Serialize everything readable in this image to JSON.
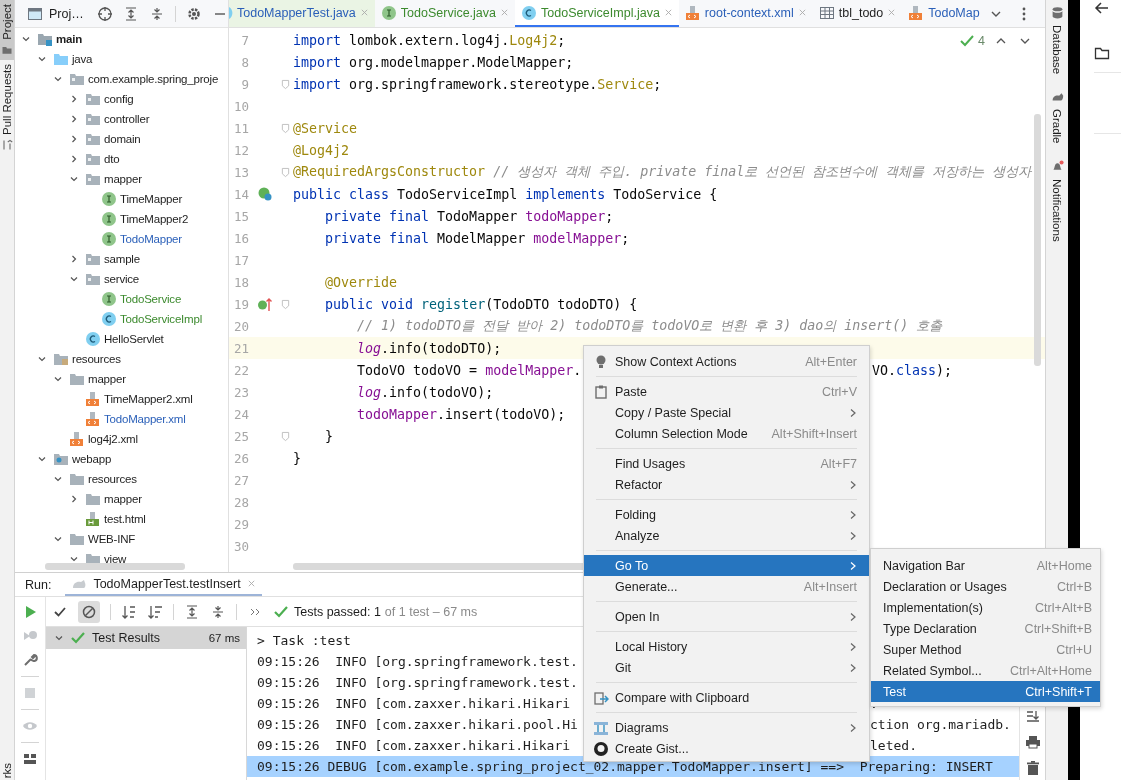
{
  "left_strip": {
    "tools": [
      {
        "label": "Project",
        "kind": "project",
        "selected": true
      },
      {
        "label": "Pull Requests",
        "kind": "pull-requests",
        "selected": false
      }
    ],
    "bottom_tool": "rks"
  },
  "project": {
    "title": "Proj…",
    "tree": [
      {
        "label": "main",
        "kind": "module",
        "added": false,
        "modified": false,
        "expanded": true,
        "children": [
          {
            "label": "java",
            "kind": "source-folder",
            "added": false,
            "modified": false,
            "expanded": true,
            "children": [
              {
                "label": "com.example.spring_proje",
                "kind": "package",
                "added": false,
                "modified": false,
                "expanded": true,
                "children": [
                  {
                    "label": "config",
                    "kind": "package",
                    "added": false,
                    "modified": false,
                    "expanded": false
                  },
                  {
                    "label": "controller",
                    "kind": "package",
                    "added": false,
                    "modified": false,
                    "expanded": false
                  },
                  {
                    "label": "domain",
                    "kind": "package",
                    "added": false,
                    "modified": false,
                    "expanded": false
                  },
                  {
                    "label": "dto",
                    "kind": "package",
                    "added": false,
                    "modified": false,
                    "expanded": false
                  },
                  {
                    "label": "mapper",
                    "kind": "package",
                    "added": false,
                    "modified": false,
                    "expanded": true,
                    "children": [
                      {
                        "label": "TimeMapper",
                        "kind": "interface",
                        "added": false,
                        "modified": false
                      },
                      {
                        "label": "TimeMapper2",
                        "kind": "interface",
                        "added": false,
                        "modified": false
                      },
                      {
                        "label": "TodoMapper",
                        "kind": "interface",
                        "added": false,
                        "modified": true
                      }
                    ]
                  },
                  {
                    "label": "sample",
                    "kind": "package",
                    "added": false,
                    "modified": false,
                    "expanded": false
                  },
                  {
                    "label": "service",
                    "kind": "package",
                    "added": false,
                    "modified": false,
                    "expanded": true,
                    "children": [
                      {
                        "label": "TodoService",
                        "kind": "interface",
                        "added": true,
                        "modified": false
                      },
                      {
                        "label": "TodoServiceImpl",
                        "kind": "class",
                        "added": true,
                        "modified": false
                      }
                    ]
                  },
                  {
                    "label": "HelloServlet",
                    "kind": "class",
                    "added": false,
                    "modified": false
                  }
                ]
              }
            ]
          },
          {
            "label": "resources",
            "kind": "resources-folder",
            "added": false,
            "modified": false,
            "expanded": true,
            "children": [
              {
                "label": "mapper",
                "kind": "folder",
                "added": false,
                "modified": false,
                "expanded": true,
                "children": [
                  {
                    "label": "TimeMapper2.xml",
                    "kind": "xml",
                    "added": false,
                    "modified": false
                  },
                  {
                    "label": "TodoMapper.xml",
                    "kind": "xml",
                    "added": false,
                    "modified": true
                  }
                ]
              },
              {
                "label": "log4j2.xml",
                "kind": "xml",
                "added": false,
                "modified": false
              }
            ]
          },
          {
            "label": "webapp",
            "kind": "web-folder",
            "added": false,
            "modified": false,
            "expanded": true,
            "children": [
              {
                "label": "resources",
                "kind": "folder",
                "added": false,
                "modified": false,
                "expanded": true,
                "children": [
                  {
                    "label": "mapper",
                    "kind": "folder",
                    "added": false,
                    "modified": false,
                    "expanded": false
                  },
                  {
                    "label": "test.html",
                    "kind": "html",
                    "added": false,
                    "modified": false
                  }
                ]
              },
              {
                "label": "WEB-INF",
                "kind": "folder",
                "added": false,
                "modified": false,
                "expanded": true,
                "children": [
                  {
                    "label": "view",
                    "kind": "folder",
                    "added": false,
                    "modified": false,
                    "expanded": true
                  }
                ]
              }
            ]
          }
        ]
      }
    ]
  },
  "editor": {
    "tabs": [
      {
        "label": "TodoMapperTest.java",
        "kind": "test-class",
        "added": false,
        "modified": true,
        "closable": true,
        "selected": false
      },
      {
        "label": "TodoService.java",
        "kind": "interface",
        "added": true,
        "modified": false,
        "closable": true,
        "selected": false
      },
      {
        "label": "TodoServiceImpl.java",
        "kind": "class",
        "added": true,
        "modified": false,
        "closable": true,
        "selected": true
      },
      {
        "label": "root-context.xml",
        "kind": "xml",
        "added": false,
        "modified": true,
        "closable": true,
        "selected": false
      },
      {
        "label": "tbl_todo",
        "kind": "table",
        "added": false,
        "modified": false,
        "closable": true,
        "selected": false
      },
      {
        "label": "TodoMap",
        "kind": "xml",
        "added": false,
        "modified": true,
        "closable": false,
        "selected": false
      }
    ],
    "inspection_count": "4",
    "lines": [
      {
        "number": "7",
        "kind": "plain",
        "fold": false,
        "current": false,
        "segments": [
          {
            "kind": "keyword",
            "text": "import"
          },
          {
            "kind": "plain",
            "text": " lombok.extern.log4j."
          },
          {
            "kind": "annotation",
            "text": "Log4j2"
          },
          {
            "kind": "plain",
            "text": ";"
          }
        ]
      },
      {
        "number": "8",
        "kind": "plain",
        "fold": false,
        "current": false,
        "segments": [
          {
            "kind": "keyword",
            "text": "import"
          },
          {
            "kind": "plain",
            "text": " org.modelmapper.ModelMapper;"
          }
        ]
      },
      {
        "number": "9",
        "kind": "plain",
        "fold": true,
        "current": false,
        "segments": [
          {
            "kind": "keyword",
            "text": "import"
          },
          {
            "kind": "plain",
            "text": " org.springframework.stereotype."
          },
          {
            "kind": "annotation",
            "text": "Service"
          },
          {
            "kind": "plain",
            "text": ";"
          }
        ]
      },
      {
        "number": "10",
        "kind": "plain",
        "fold": false,
        "current": false
      },
      {
        "number": "11",
        "kind": "plain",
        "fold": true,
        "current": false,
        "segments": [
          {
            "kind": "annotation",
            "text": "@Service"
          }
        ]
      },
      {
        "number": "12",
        "kind": "plain",
        "fold": false,
        "current": false,
        "segments": [
          {
            "kind": "annotation",
            "text": "@Log4j2"
          }
        ]
      },
      {
        "number": "13",
        "kind": "plain",
        "fold": true,
        "current": false,
        "segments": [
          {
            "kind": "annotation",
            "text": "@RequiredArgsConstructor"
          },
          {
            "kind": "comment",
            "text": " // 생성자 객체 주입. private final로 선언된 참조변수에 객체를 저장하는 생성자"
          }
        ]
      },
      {
        "number": "14",
        "kind": "implements",
        "fold": false,
        "current": false,
        "segments": [
          {
            "kind": "keyword",
            "text": "public class"
          },
          {
            "kind": "plain",
            "text": " TodoServiceImpl "
          },
          {
            "kind": "keyword",
            "text": "implements"
          },
          {
            "kind": "plain",
            "text": " TodoService {"
          }
        ]
      },
      {
        "number": "15",
        "kind": "plain",
        "fold": false,
        "current": false,
        "segments": [
          {
            "kind": "keyword",
            "text": "    private final"
          },
          {
            "kind": "plain",
            "text": " TodoMapper "
          },
          {
            "kind": "field",
            "text": "todoMapper"
          },
          {
            "kind": "plain",
            "text": ";"
          }
        ]
      },
      {
        "number": "16",
        "kind": "plain",
        "fold": false,
        "current": false,
        "segments": [
          {
            "kind": "keyword",
            "text": "    private final"
          },
          {
            "kind": "plain",
            "text": " ModelMapper "
          },
          {
            "kind": "field",
            "text": "modelMapper"
          },
          {
            "kind": "plain",
            "text": ";"
          }
        ]
      },
      {
        "number": "17",
        "kind": "plain",
        "fold": false,
        "current": false
      },
      {
        "number": "18",
        "kind": "plain",
        "fold": false,
        "current": false,
        "segments": [
          {
            "kind": "annotation",
            "text": "    @Override"
          }
        ]
      },
      {
        "number": "19",
        "kind": "overrides",
        "fold": true,
        "current": false,
        "segments": [
          {
            "kind": "keyword",
            "text": "    public void"
          },
          {
            "kind": "method",
            "text": " register"
          },
          {
            "kind": "plain",
            "text": "(TodoDTO todoDTO) {"
          }
        ]
      },
      {
        "number": "20",
        "kind": "plain",
        "fold": false,
        "current": false,
        "segments": [
          {
            "kind": "comment",
            "text": "        // 1) todoDTO를 전달 받아 2) todoDTO를 todoVO로 변환 후 3) dao의 insert() 호출"
          }
        ]
      },
      {
        "number": "21",
        "kind": "plain",
        "fold": false,
        "current": true,
        "segments": [
          {
            "kind": "static",
            "text": "        log"
          },
          {
            "kind": "plain",
            "text": ".info(todoDTO);"
          }
        ]
      },
      {
        "number": "22",
        "kind": "plain",
        "fold": false,
        "current": false,
        "segments": [
          {
            "kind": "plain",
            "text": "        TodoVO todoVO = "
          },
          {
            "kind": "field",
            "text": "modelMapper"
          },
          {
            "kind": "plain",
            "text": "."
          }
        ],
        "tail": [
          {
            "kind": "plain",
            "text": "VO."
          },
          {
            "kind": "keyword",
            "text": "class"
          },
          {
            "kind": "plain",
            "text": ");"
          }
        ]
      },
      {
        "number": "23",
        "kind": "plain",
        "fold": false,
        "current": false,
        "segments": [
          {
            "kind": "static",
            "text": "        log"
          },
          {
            "kind": "plain",
            "text": ".info(todoVO);"
          }
        ]
      },
      {
        "number": "24",
        "kind": "plain",
        "fold": false,
        "current": false,
        "segments": [
          {
            "kind": "field",
            "text": "        todoMapper"
          },
          {
            "kind": "plain",
            "text": ".insert(todoVO);"
          }
        ]
      },
      {
        "number": "25",
        "kind": "plain",
        "fold": true,
        "current": false,
        "segments": [
          {
            "kind": "plain",
            "text": "    }"
          }
        ]
      },
      {
        "number": "26",
        "kind": "plain",
        "fold": false,
        "current": false,
        "segments": [
          {
            "kind": "plain",
            "text": "}"
          }
        ]
      },
      {
        "number": "27",
        "kind": "plain",
        "fold": false,
        "current": false
      },
      {
        "number": "28",
        "kind": "plain",
        "fold": false,
        "current": false
      },
      {
        "number": "29",
        "kind": "plain",
        "fold": false,
        "current": false
      },
      {
        "number": "30",
        "kind": "plain",
        "fold": false,
        "current": false
      }
    ]
  },
  "right_strip": {
    "tools": [
      {
        "label": "Database",
        "kind": "database"
      },
      {
        "label": "Gradle",
        "kind": "gradle"
      },
      {
        "label": "Notifications",
        "kind": "notifications"
      }
    ]
  },
  "run": {
    "label": "Run:",
    "tab": "TodoMapperTest.testInsert",
    "status_main": "Tests passed: 1",
    "status_detail": "of 1 test – 67 ms",
    "results": [
      {
        "label": "Test Results",
        "time": "67 ms",
        "selected": true,
        "expanded": true
      }
    ],
    "console": [
      {
        "text": "> Task :test",
        "selected": false
      },
      {
        "text": "09:15:26  INFO [org.springframework.test.",
        "selected": false
      },
      {
        "text": "09:15:26  INFO [org.springframework.test.",
        "selected": false
      },
      {
        "text": "09:15:26  INFO [com.zaxxer.hikari.Hikari",
        "tail": ".",
        "selected": false
      },
      {
        "text": "09:15:26  INFO [com.zaxxer.hikari.pool.Hi",
        "tail": "ction org.mariadb.",
        "selected": false
      },
      {
        "text": "09:15:26  INFO [com.zaxxer.hikari.Hikari",
        "tail": "leted.",
        "selected": false
      },
      {
        "text": "09:15:26 DEBUG [com.example.spring_project_02.mapper.TodoMapper.insert] ==>  Preparing: INSERT",
        "selected": true
      }
    ]
  },
  "context_menu": {
    "items": [
      {
        "kind": "bulb",
        "label": "Show Context Actions",
        "shortcut": "Alt+Enter",
        "submenu": false,
        "selected": false
      },
      {
        "kind": "separator"
      },
      {
        "kind": "clipboard",
        "label": "Paste",
        "shortcut": "Ctrl+V",
        "submenu": false,
        "selected": false
      },
      {
        "kind": "plain",
        "label": "Copy / Paste Special",
        "submenu": true,
        "selected": false
      },
      {
        "kind": "plain",
        "label": "Column Selection Mode",
        "shortcut": "Alt+Shift+Insert",
        "submenu": false,
        "selected": false
      },
      {
        "kind": "separator"
      },
      {
        "kind": "plain",
        "label": "Find Usages",
        "shortcut": "Alt+F7",
        "submenu": false,
        "selected": false
      },
      {
        "kind": "plain",
        "label": "Refactor",
        "submenu": true,
        "selected": false
      },
      {
        "kind": "separator"
      },
      {
        "kind": "plain",
        "label": "Folding",
        "submenu": true,
        "selected": false
      },
      {
        "kind": "plain",
        "label": "Analyze",
        "submenu": true,
        "selected": false
      },
      {
        "kind": "separator"
      },
      {
        "kind": "plain",
        "label": "Go To",
        "submenu": true,
        "selected": true
      },
      {
        "kind": "plain",
        "label": "Generate...",
        "shortcut": "Alt+Insert",
        "submenu": false,
        "selected": false
      },
      {
        "kind": "separator"
      },
      {
        "kind": "plain",
        "label": "Open In",
        "submenu": true,
        "selected": false
      },
      {
        "kind": "separator"
      },
      {
        "kind": "plain",
        "label": "Local History",
        "submenu": true,
        "selected": false
      },
      {
        "kind": "plain",
        "label": "Git",
        "submenu": true,
        "selected": false
      },
      {
        "kind": "separator"
      },
      {
        "kind": "compare",
        "label": "Compare with Clipboard",
        "submenu": false,
        "selected": false
      },
      {
        "kind": "separator"
      },
      {
        "kind": "diagram",
        "label": "Diagrams",
        "submenu": true,
        "selected": false
      },
      {
        "kind": "github",
        "label": "Create Gist...",
        "submenu": false,
        "selected": false
      }
    ]
  },
  "submenu": {
    "items": [
      {
        "label": "Navigation Bar",
        "shortcut": "Alt+Home",
        "selected": false
      },
      {
        "label": "Declaration or Usages",
        "shortcut": "Ctrl+B",
        "selected": false
      },
      {
        "label": "Implementation(s)",
        "shortcut": "Ctrl+Alt+B",
        "selected": false
      },
      {
        "label": "Type Declaration",
        "shortcut": "Ctrl+Shift+B",
        "selected": false
      },
      {
        "label": "Super Method",
        "shortcut": "Ctrl+U",
        "selected": false
      },
      {
        "label": "Related Symbol...",
        "shortcut": "Ctrl+Alt+Home",
        "selected": false
      },
      {
        "label": "Test",
        "shortcut": "Ctrl+Shift+T",
        "selected": true
      }
    ]
  }
}
